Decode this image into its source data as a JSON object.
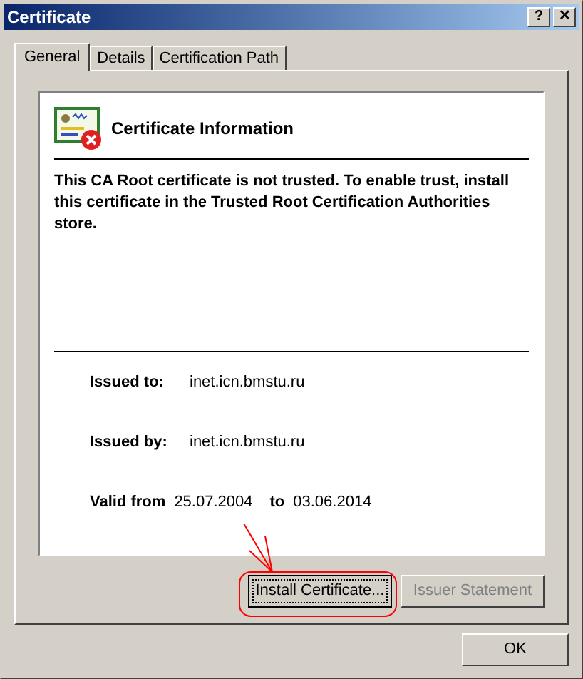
{
  "window": {
    "title": "Certificate",
    "buttons": [
      "?",
      "✕"
    ]
  },
  "tabs": [
    {
      "label": "General",
      "selected": true
    },
    {
      "label": "Details",
      "selected": false
    },
    {
      "label": "Certification Path",
      "selected": false
    }
  ],
  "info": {
    "heading": "Certificate Information",
    "message": "This CA Root certificate is not trusted. To enable trust, install this certificate in the Trusted Root Certification Authorities store.",
    "issued_to_label": "Issued to:",
    "issued_to": "inet.icn.bmstu.ru",
    "issued_by_label": "Issued by:",
    "issued_by": "inet.icn.bmstu.ru",
    "valid_from_label": "Valid from",
    "valid_from": "25.07.2004",
    "valid_to_label": "to",
    "valid_to": "03.06.2014"
  },
  "panel_buttons": [
    {
      "label": "Install Certificate...",
      "disabled": false,
      "focused": true
    },
    {
      "label": "Issuer Statement",
      "disabled": true,
      "focused": false
    }
  ],
  "ok_button": "OK"
}
